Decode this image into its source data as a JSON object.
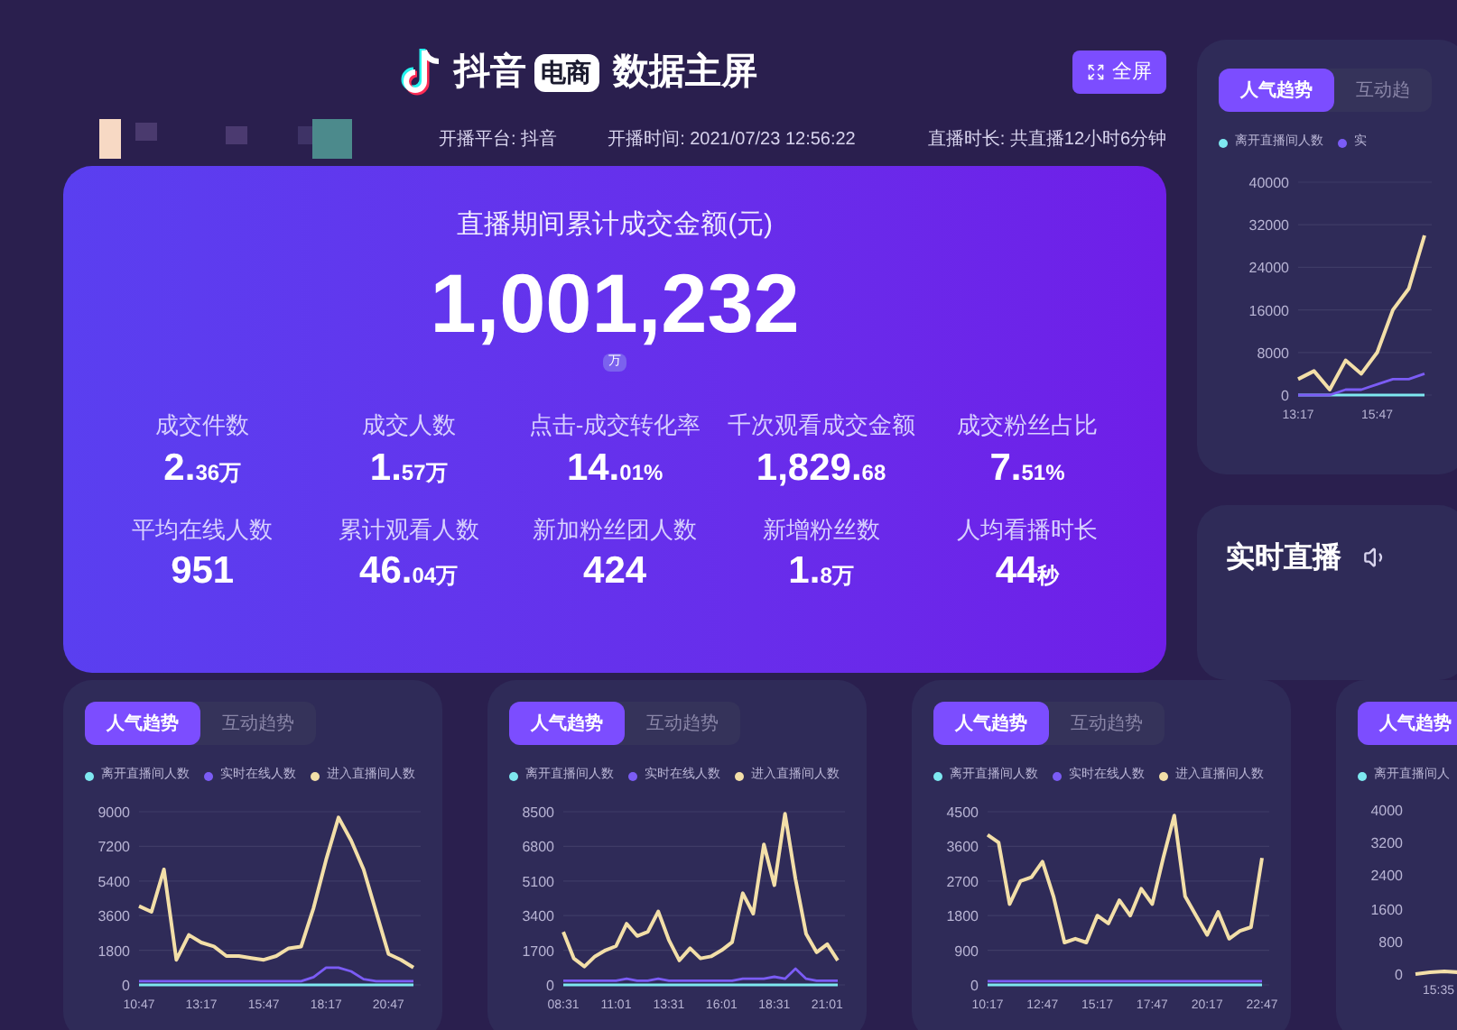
{
  "header": {
    "brand": "抖音",
    "badge": "电商",
    "title": "数据主屏",
    "fullscreen_button": "全屏",
    "info": [
      "开播平台: 抖音",
      "开播时间: 2021/07/23 12:56:22",
      "直播时长: 共直播12小时6分钟"
    ]
  },
  "summary": {
    "title": "直播期间累计成交金额(元)",
    "total": "1,001,232",
    "unit_badge": "万",
    "metrics": [
      {
        "label": "成交件数",
        "value_main": "2.",
        "value_small": "36万"
      },
      {
        "label": "成交人数",
        "value_main": "1.",
        "value_small": "57万"
      },
      {
        "label": "点击-成交转化率",
        "value_main": "14.",
        "value_small": "01%"
      },
      {
        "label": "千次观看成交金额",
        "value_main": "1,829.",
        "value_small": "68"
      },
      {
        "label": "成交粉丝占比",
        "value_main": "7.",
        "value_small": "51%"
      },
      {
        "label": "平均在线人数",
        "value_main": "951"
      },
      {
        "label": "累计观看人数",
        "value_main": "46.",
        "value_small": "04万"
      },
      {
        "label": "新加粉丝团人数",
        "value_main": "424"
      },
      {
        "label": "新增粉丝数",
        "value_main": "1.",
        "value_small": "8万"
      },
      {
        "label": "人均看播时长",
        "value_main": "44",
        "value_small": "秒"
      }
    ]
  },
  "side_trend": {
    "tabs": [
      {
        "label": "人气趋势",
        "selected": true
      },
      {
        "label": "互动趋",
        "selected": false
      }
    ],
    "chart_data": {
      "type": "line",
      "grid": true,
      "categories": [
        "13:17",
        null,
        null,
        null,
        null,
        "15:47",
        null,
        null,
        null
      ],
      "ylim": [
        0,
        40000
      ],
      "yticks": [
        0,
        8000,
        16000,
        24000,
        32000,
        40000
      ],
      "series": [
        {
          "name": "离开直播间人数",
          "color": "#7ee8f0",
          "values": [
            0,
            0,
            0,
            0,
            0,
            0,
            0,
            0,
            0
          ]
        },
        {
          "name": "实",
          "color": "#7b5cf5",
          "values": [
            0,
            0,
            0,
            1000,
            1000,
            2000,
            3000,
            3000,
            4000
          ]
        },
        {
          "color": "#f3dfa8",
          "values": [
            3000,
            4500,
            1000,
            6500,
            4000,
            8000,
            16000,
            20000,
            30000
          ]
        }
      ]
    }
  },
  "live": {
    "title": "实时直播"
  },
  "trend_cards": [
    {
      "tabs": [
        {
          "label": "人气趋势",
          "selected": true
        },
        {
          "label": "互动趋势",
          "selected": false
        }
      ],
      "chart_data": {
        "type": "line",
        "grid": true,
        "categories": [
          "10:47",
          null,
          null,
          null,
          null,
          "13:17",
          null,
          null,
          null,
          null,
          "15:47",
          null,
          null,
          null,
          null,
          "18:17",
          null,
          null,
          null,
          null,
          "20:47",
          null,
          null
        ],
        "ylim": [
          0,
          9000
        ],
        "yticks": [
          0,
          1800,
          3600,
          5400,
          7200,
          9000
        ],
        "series": [
          {
            "name": "离开直播间人数",
            "color": "#7ee8f0",
            "values": [
              0,
              0,
              0,
              0,
              0,
              0,
              0,
              0,
              0,
              0,
              0,
              0,
              0,
              0,
              0,
              0,
              0,
              0,
              0,
              0,
              0,
              0,
              0
            ]
          },
          {
            "name": "实时在线人数",
            "color": "#7b5cf5",
            "values": [
              200,
              200,
              200,
              200,
              200,
              200,
              200,
              200,
              200,
              200,
              200,
              200,
              200,
              200,
              400,
              900,
              900,
              700,
              300,
              200,
              200,
              200,
              200
            ]
          },
          {
            "name": "进入直播间人数",
            "color": "#f3dfa8",
            "values": [
              4100,
              3800,
              6000,
              1300,
              2600,
              2200,
              2000,
              1500,
              1500,
              1400,
              1300,
              1500,
              1900,
              2000,
              4000,
              6500,
              8700,
              7500,
              6000,
              3800,
              1600,
              1300,
              900
            ]
          }
        ]
      }
    },
    {
      "tabs": [
        {
          "label": "人气趋势",
          "selected": true
        },
        {
          "label": "互动趋势",
          "selected": false
        }
      ],
      "chart_data": {
        "type": "line",
        "grid": true,
        "categories": [
          "08:31",
          null,
          null,
          null,
          null,
          "11:01",
          null,
          null,
          null,
          null,
          "13:31",
          null,
          null,
          null,
          null,
          "16:01",
          null,
          null,
          null,
          null,
          "18:31",
          null,
          null,
          null,
          null,
          "21:01",
          null
        ],
        "ylim": [
          0,
          8500
        ],
        "yticks": [
          0,
          1700,
          3400,
          5100,
          6800,
          8500
        ],
        "series": [
          {
            "name": "离开直播间人数",
            "color": "#7ee8f0",
            "values": [
              0,
              0,
              0,
              0,
              0,
              0,
              0,
              0,
              0,
              0,
              0,
              0,
              0,
              0,
              0,
              0,
              0,
              0,
              0,
              0,
              0,
              0,
              0,
              0,
              0,
              0,
              0
            ]
          },
          {
            "name": "实时在线人数",
            "color": "#7b5cf5",
            "values": [
              200,
              200,
              200,
              200,
              200,
              200,
              300,
              200,
              200,
              300,
              200,
              200,
              200,
              200,
              200,
              200,
              200,
              300,
              300,
              300,
              400,
              300,
              800,
              300,
              200,
              200,
              200
            ]
          },
          {
            "name": "进入直播间人数",
            "color": "#f3dfa8",
            "values": [
              2600,
              1300,
              900,
              1400,
              1700,
              1900,
              3000,
              2400,
              2600,
              3600,
              2200,
              1200,
              1800,
              1300,
              1400,
              1700,
              2100,
              4500,
              3500,
              6900,
              4900,
              8400,
              5200,
              2500,
              1600,
              2000,
              1200
            ]
          }
        ]
      }
    },
    {
      "tabs": [
        {
          "label": "人气趋势",
          "selected": true
        },
        {
          "label": "互动趋势",
          "selected": false
        }
      ],
      "chart_data": {
        "type": "line",
        "grid": true,
        "categories": [
          "10:17",
          null,
          null,
          null,
          null,
          "12:47",
          null,
          null,
          null,
          null,
          "15:17",
          null,
          null,
          null,
          null,
          "17:47",
          null,
          null,
          null,
          null,
          "20:17",
          null,
          null,
          null,
          null,
          "22:47"
        ],
        "ylim": [
          0,
          4500
        ],
        "yticks": [
          0,
          900,
          1800,
          2700,
          3600,
          4500
        ],
        "series": [
          {
            "name": "离开直播间人数",
            "color": "#7ee8f0",
            "values": [
              0,
              0,
              0,
              0,
              0,
              0,
              0,
              0,
              0,
              0,
              0,
              0,
              0,
              0,
              0,
              0,
              0,
              0,
              0,
              0,
              0,
              0,
              0,
              0,
              0,
              0
            ]
          },
          {
            "name": "实时在线人数",
            "color": "#7b5cf5",
            "values": [
              100,
              100,
              100,
              100,
              100,
              100,
              100,
              100,
              100,
              100,
              100,
              100,
              100,
              100,
              100,
              100,
              100,
              100,
              100,
              100,
              100,
              100,
              100,
              100,
              100,
              100
            ]
          },
          {
            "name": "进入直播间人数",
            "color": "#f3dfa8",
            "values": [
              3900,
              3700,
              2100,
              2700,
              2800,
              3200,
              2300,
              1100,
              1200,
              1100,
              1800,
              1600,
              2200,
              1800,
              2500,
              2100,
              3300,
              4400,
              2300,
              1800,
              1300,
              1900,
              1200,
              1400,
              1500,
              3300
            ]
          }
        ]
      }
    },
    {
      "tabs": [
        {
          "label": "人气趋势",
          "selected": true
        }
      ],
      "legend": [
        "离开直播间人"
      ],
      "y_labels": [
        "4000",
        "3200",
        "2400",
        "1600",
        "800",
        "0"
      ],
      "x_labels": [
        "15:35"
      ]
    }
  ]
}
